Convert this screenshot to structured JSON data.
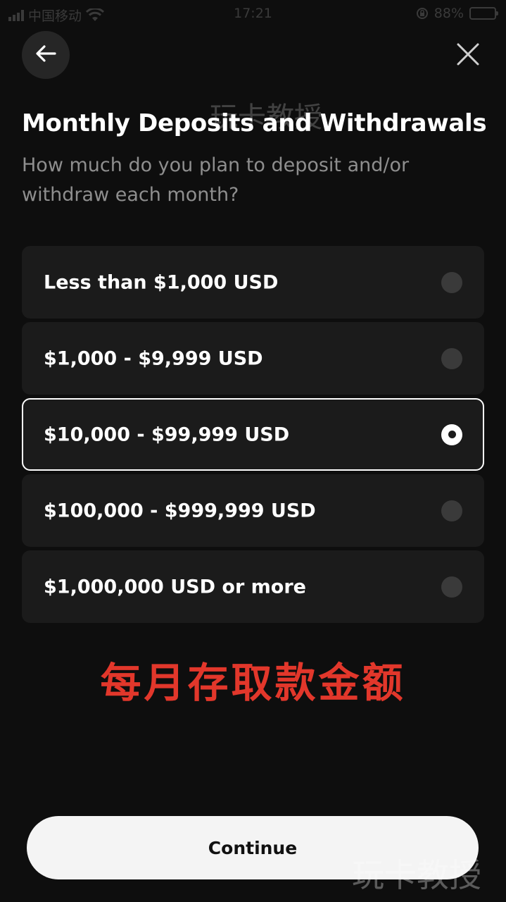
{
  "status_bar": {
    "carrier": "中国移动",
    "time": "17:21",
    "battery": "88%",
    "color": "#3a3a3a"
  },
  "header": {
    "back_icon": "arrow-left-icon",
    "close_icon": "close-icon"
  },
  "watermark": "玩卡教授",
  "title": "Monthly Deposits and Withdrawals",
  "subtitle": "How much do you plan to deposit and/or withdraw each month?",
  "options": [
    {
      "label": "Less than $1,000 USD",
      "selected": false
    },
    {
      "label": "$1,000 - $9,999 USD",
      "selected": false
    },
    {
      "label": "$10,000 - $99,999 USD",
      "selected": true
    },
    {
      "label": "$100,000 - $999,999 USD",
      "selected": false
    },
    {
      "label": "$1,000,000 USD or more",
      "selected": false
    }
  ],
  "annotation": "每月存取款金额",
  "continue_label": "Continue",
  "colors": {
    "background": "#0e0e0e",
    "card": "#1b1b1b",
    "accent_annotation": "#e2372b",
    "button": "#f4f4f4"
  }
}
